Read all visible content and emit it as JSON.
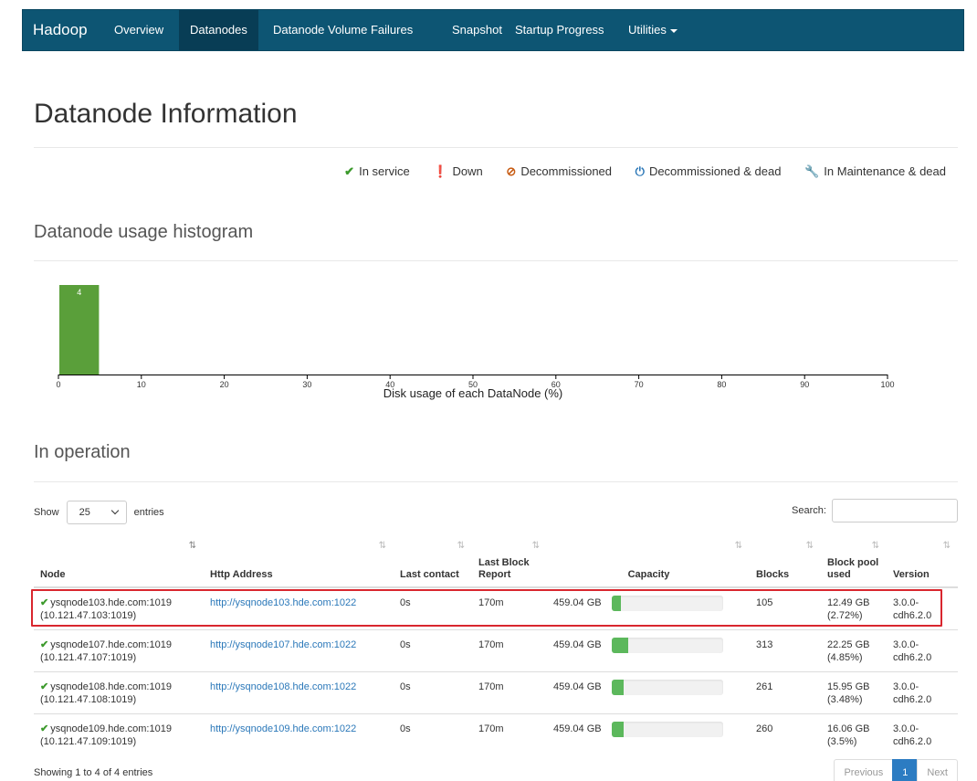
{
  "nav": {
    "brand": "Hadoop",
    "items": [
      {
        "label": "Overview"
      },
      {
        "label": "Datanodes"
      },
      {
        "label": "Datanode Volume Failures"
      },
      {
        "label": "Snapshot"
      },
      {
        "label": "Startup Progress"
      },
      {
        "label": "Utilities"
      }
    ],
    "active": "Datanodes"
  },
  "page_title": "Datanode Information",
  "legend": {
    "in_service": "In service",
    "down": "Down",
    "decommissioned": "Decommissioned",
    "decommissioned_dead": "Decommissioned & dead",
    "maintenance_dead": "In Maintenance & dead"
  },
  "histogram_title": "Datanode usage histogram",
  "chart_data": {
    "type": "bar",
    "bins": [
      [
        0,
        5
      ]
    ],
    "counts": [
      4
    ],
    "bar_labels": [
      "4"
    ],
    "xlabel": "Disk usage of each DataNode (%)",
    "xlim": [
      0,
      100
    ],
    "xticks": [
      0,
      10,
      20,
      30,
      40,
      50,
      60,
      70,
      80,
      90,
      100
    ],
    "bar_color": "#5a9f3a"
  },
  "operation_title": "In operation",
  "table_controls": {
    "show_label": "Show",
    "entries_value": "25",
    "entries_label": "entries",
    "search_label": "Search:"
  },
  "table": {
    "headers": {
      "node": "Node",
      "http": "Http Address",
      "last_contact": "Last contact",
      "last_block_report": "Last Block Report",
      "capacity": "Capacity",
      "blocks": "Blocks",
      "block_pool_used": "Block pool used",
      "version": "Version"
    },
    "rows": [
      {
        "node": "ysqnode103.hde.com:1019",
        "node_ip": "(10.121.47.103:1019)",
        "http": "http://ysqnode103.hde.com:1022",
        "last_contact": "0s",
        "last_block_report": "170m",
        "capacity": "459.04 GB",
        "capacity_used_pct": 2.72,
        "blocks": "105",
        "bpu": "12.49 GB",
        "bpu_pct": "(2.72%)",
        "version": "3.0.0-",
        "version2": "cdh6.2.0"
      },
      {
        "node": "ysqnode107.hde.com:1019",
        "node_ip": "(10.121.47.107:1019)",
        "http": "http://ysqnode107.hde.com:1022",
        "last_contact": "0s",
        "last_block_report": "170m",
        "capacity": "459.04 GB",
        "capacity_used_pct": 4.85,
        "blocks": "313",
        "bpu": "22.25 GB",
        "bpu_pct": "(4.85%)",
        "version": "3.0.0-",
        "version2": "cdh6.2.0"
      },
      {
        "node": "ysqnode108.hde.com:1019",
        "node_ip": "(10.121.47.108:1019)",
        "http": "http://ysqnode108.hde.com:1022",
        "last_contact": "0s",
        "last_block_report": "170m",
        "capacity": "459.04 GB",
        "capacity_used_pct": 3.48,
        "blocks": "261",
        "bpu": "15.95 GB",
        "bpu_pct": "(3.48%)",
        "version": "3.0.0-",
        "version2": "cdh6.2.0"
      },
      {
        "node": "ysqnode109.hde.com:1019",
        "node_ip": "(10.121.47.109:1019)",
        "http": "http://ysqnode109.hde.com:1022",
        "last_contact": "0s",
        "last_block_report": "170m",
        "capacity": "459.04 GB",
        "capacity_used_pct": 3.5,
        "blocks": "260",
        "bpu": "16.06 GB",
        "bpu_pct": "(3.5%)",
        "version": "3.0.0-",
        "version2": "cdh6.2.0"
      }
    ]
  },
  "footer": {
    "info": "Showing 1 to 4 of 4 entries",
    "previous": "Previous",
    "page": "1",
    "next": "Next"
  }
}
